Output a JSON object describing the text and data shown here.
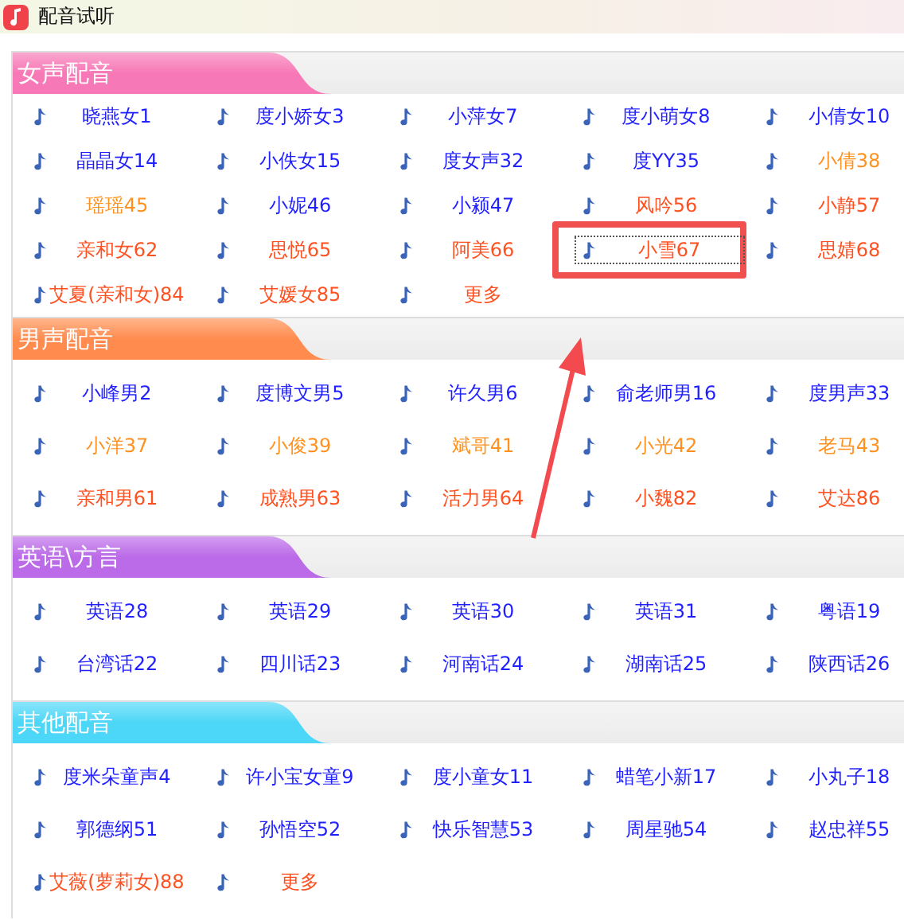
{
  "window": {
    "title": "配音试听"
  },
  "annotation_arrow": true,
  "sections": [
    {
      "title": "女声配音",
      "color": "#f778b6",
      "items": [
        {
          "label": "晓燕女1",
          "color": "#1f1fff",
          "selected": false
        },
        {
          "label": "度小娇女3",
          "color": "#1f1fff",
          "selected": false
        },
        {
          "label": "小萍女7",
          "color": "#1f1fff",
          "selected": false
        },
        {
          "label": "度小萌女8",
          "color": "#1f1fff",
          "selected": false
        },
        {
          "label": "小倩女10",
          "color": "#1f1fff",
          "selected": false
        },
        {
          "label": "晶晶女14",
          "color": "#1f1fff",
          "selected": false
        },
        {
          "label": "小佚女15",
          "color": "#1f1fff",
          "selected": false
        },
        {
          "label": "度女声32",
          "color": "#1f1fff",
          "selected": false
        },
        {
          "label": "度YY35",
          "color": "#1f1fff",
          "selected": false
        },
        {
          "label": "小倩38",
          "color": "#ff921f",
          "selected": false
        },
        {
          "label": "瑶瑶45",
          "color": "#ff921f",
          "selected": false
        },
        {
          "label": "小妮46",
          "color": "#1f1fff",
          "selected": false
        },
        {
          "label": "小颍47",
          "color": "#1f1fff",
          "selected": false
        },
        {
          "label": "风吟56",
          "color": "#ff5020",
          "selected": false
        },
        {
          "label": "小静57",
          "color": "#ff5020",
          "selected": false
        },
        {
          "label": "亲和女62",
          "color": "#ff5020",
          "selected": false
        },
        {
          "label": "思悦65",
          "color": "#ff5020",
          "selected": false
        },
        {
          "label": "阿美66",
          "color": "#ff5020",
          "selected": false
        },
        {
          "label": "小雪67",
          "color": "#ff5020",
          "selected": true
        },
        {
          "label": "思婧68",
          "color": "#ff5020",
          "selected": false
        },
        {
          "label": "艾夏(亲和女)84",
          "color": "#ff5020",
          "selected": false
        },
        {
          "label": "艾媛女85",
          "color": "#ff5020",
          "selected": false
        },
        {
          "label": "更多",
          "color": "#ff5020",
          "selected": false
        }
      ]
    },
    {
      "title": "男声配音",
      "color": "#ff8c4e",
      "items": [
        {
          "label": "小峰男2",
          "color": "#1f1fff",
          "selected": false
        },
        {
          "label": "度博文男5",
          "color": "#1f1fff",
          "selected": false
        },
        {
          "label": "许久男6",
          "color": "#1f1fff",
          "selected": false
        },
        {
          "label": "俞老师男16",
          "color": "#1f1fff",
          "selected": false
        },
        {
          "label": "度男声33",
          "color": "#1f1fff",
          "selected": false
        },
        {
          "label": "小洋37",
          "color": "#ff921f",
          "selected": false
        },
        {
          "label": "小俊39",
          "color": "#ff921f",
          "selected": false
        },
        {
          "label": "斌哥41",
          "color": "#ff921f",
          "selected": false
        },
        {
          "label": "小光42",
          "color": "#ff921f",
          "selected": false
        },
        {
          "label": "老马43",
          "color": "#ff921f",
          "selected": false
        },
        {
          "label": "亲和男61",
          "color": "#ff5020",
          "selected": false
        },
        {
          "label": "成熟男63",
          "color": "#ff5020",
          "selected": false
        },
        {
          "label": "活力男64",
          "color": "#ff5020",
          "selected": false
        },
        {
          "label": "小魏82",
          "color": "#ff5020",
          "selected": false
        },
        {
          "label": "艾达86",
          "color": "#ff5020",
          "selected": false
        }
      ]
    },
    {
      "title": "英语\\方言",
      "color": "#bb6ae8",
      "items": [
        {
          "label": "英语28",
          "color": "#1f1fff",
          "selected": false
        },
        {
          "label": "英语29",
          "color": "#1f1fff",
          "selected": false
        },
        {
          "label": "英语30",
          "color": "#1f1fff",
          "selected": false
        },
        {
          "label": "英语31",
          "color": "#1f1fff",
          "selected": false
        },
        {
          "label": "粤语19",
          "color": "#1f1fff",
          "selected": false
        },
        {
          "label": "台湾话22",
          "color": "#1f1fff",
          "selected": false
        },
        {
          "label": "四川话23",
          "color": "#1f1fff",
          "selected": false
        },
        {
          "label": "河南话24",
          "color": "#1f1fff",
          "selected": false
        },
        {
          "label": "湖南话25",
          "color": "#1f1fff",
          "selected": false
        },
        {
          "label": "陕西话26",
          "color": "#1f1fff",
          "selected": false
        }
      ]
    },
    {
      "title": "其他配音",
      "color": "#4cd6f7",
      "items": [
        {
          "label": "度米朵童声4",
          "color": "#1f1fff",
          "selected": false
        },
        {
          "label": "许小宝女童9",
          "color": "#1f1fff",
          "selected": false
        },
        {
          "label": "度小童女11",
          "color": "#1f1fff",
          "selected": false
        },
        {
          "label": "蜡笔小新17",
          "color": "#1f1fff",
          "selected": false
        },
        {
          "label": "小丸子18",
          "color": "#1f1fff",
          "selected": false
        },
        {
          "label": "郭德纲51",
          "color": "#1f1fff",
          "selected": false
        },
        {
          "label": "孙悟空52",
          "color": "#1f1fff",
          "selected": false
        },
        {
          "label": "快乐智慧53",
          "color": "#1f1fff",
          "selected": false
        },
        {
          "label": "周星驰54",
          "color": "#1f1fff",
          "selected": false
        },
        {
          "label": "赵忠祥55",
          "color": "#1f1fff",
          "selected": false
        },
        {
          "label": "艾薇(萝莉女)88",
          "color": "#ff5020",
          "selected": false
        },
        {
          "label": "更多",
          "color": "#ff5020",
          "selected": false
        }
      ]
    }
  ]
}
